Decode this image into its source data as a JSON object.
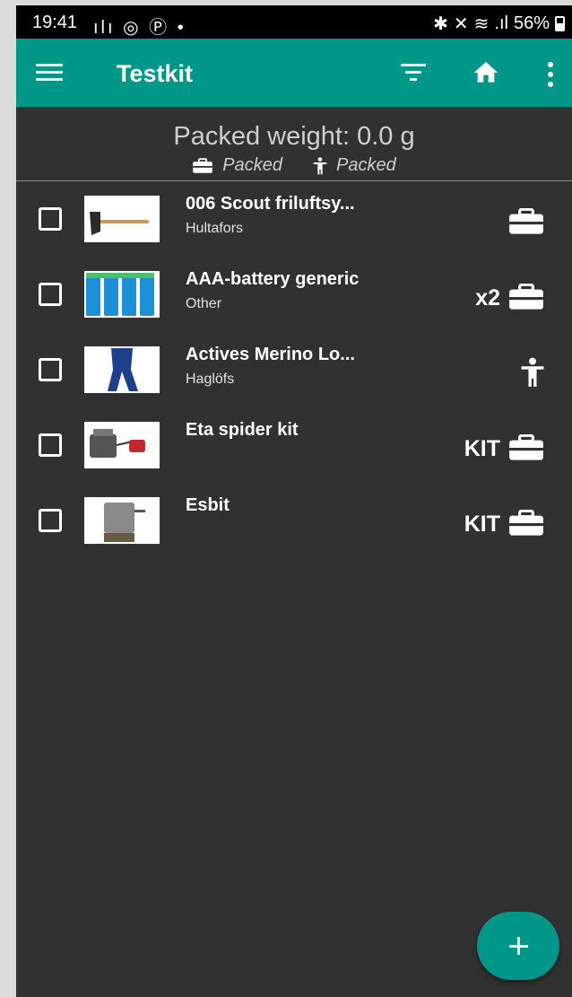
{
  "status_bar": {
    "time": "19:41",
    "left_icons": [
      "signal-bars-icon",
      "instagram-icon",
      "pinterest-icon",
      "dot-icon"
    ],
    "right_icons": [
      "bluetooth-icon",
      "mute-icon",
      "wifi-icon",
      "cell-signal-icon"
    ],
    "battery": "56%"
  },
  "app_bar": {
    "title": "Testkit",
    "icons": [
      "menu-icon",
      "filter-icon",
      "home-icon",
      "more-vert-icon"
    ],
    "color": "#009688"
  },
  "summary": {
    "weight_label": "Packed weight: 0.0 g",
    "legend": [
      {
        "icon": "briefcase-icon",
        "label": "Packed"
      },
      {
        "icon": "person-icon",
        "label": "Packed"
      }
    ]
  },
  "items": [
    {
      "name": "006 Scout friluftsy...",
      "brand": "Hultafors",
      "qty": "",
      "icon": "briefcase-icon",
      "image": "axe-image"
    },
    {
      "name": "AAA-battery generic",
      "brand": "Other",
      "qty": "x2",
      "icon": "briefcase-icon",
      "image": "batteries-image"
    },
    {
      "name": "Actives Merino Lo...",
      "brand": "Haglöfs",
      "qty": "",
      "icon": "person-icon",
      "image": "leggings-image"
    },
    {
      "name": "Eta spider kit",
      "brand": "",
      "qty": "KIT",
      "icon": "briefcase-icon",
      "image": "stove-kit-image"
    },
    {
      "name": "Esbit",
      "brand": "",
      "qty": "KIT",
      "icon": "briefcase-icon",
      "image": "esbit-pot-image"
    }
  ],
  "fab": {
    "icon": "add-icon"
  }
}
